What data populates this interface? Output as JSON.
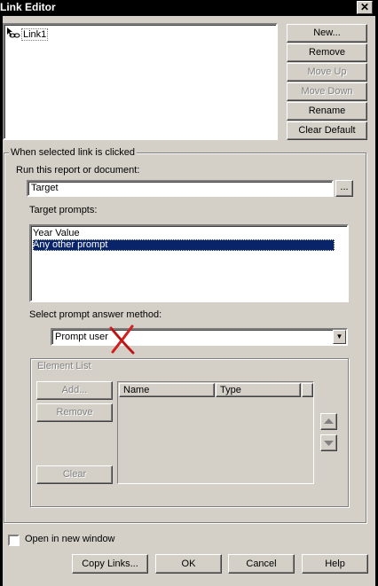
{
  "window": {
    "title": "Link Editor",
    "close_glyph": "✕"
  },
  "links": {
    "items": [
      {
        "label": "Link1",
        "icon": "link-chain-icon"
      }
    ]
  },
  "side_buttons": {
    "new": "New...",
    "remove": "Remove",
    "move_up": "Move Up",
    "move_down": "Move Down",
    "rename": "Rename",
    "clear_default": "Clear Default"
  },
  "when_clicked": {
    "group_label": "When selected link is clicked",
    "run_label": "Run this report or document:",
    "target_value": "Target",
    "browse_label": "...",
    "target_prompts_label": "Target prompts:",
    "prompts": [
      {
        "label": "Year Value",
        "selected": false
      },
      {
        "label": "Any other prompt",
        "selected": true
      }
    ],
    "answer_method_label": "Select prompt answer method:",
    "answer_method_value": "Prompt user"
  },
  "element_list": {
    "group_label": "Element List",
    "add_label": "Add...",
    "remove_label": "Remove",
    "clear_label": "Clear",
    "columns": [
      "Name",
      "Type"
    ]
  },
  "open_new_window": {
    "label": "Open in new window",
    "checked": false
  },
  "footer": {
    "copy_links": "Copy Links...",
    "ok": "OK",
    "cancel": "Cancel",
    "help": "Help"
  },
  "colors": {
    "dialog_bg": "#d4d0c8",
    "selection": "#0a246a",
    "annotation_x": "#d02020"
  }
}
